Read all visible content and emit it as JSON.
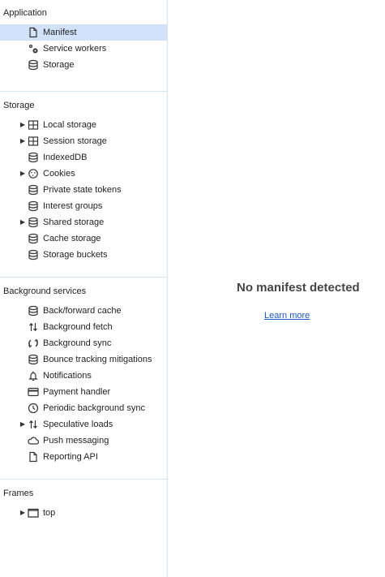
{
  "sidebar": {
    "application": {
      "title": "Application",
      "items": [
        {
          "label": "Manifest",
          "icon": "document-icon",
          "selected": true
        },
        {
          "label": "Service workers",
          "icon": "gears-icon"
        },
        {
          "label": "Storage",
          "icon": "database-icon"
        }
      ]
    },
    "storage": {
      "title": "Storage",
      "items": [
        {
          "label": "Local storage",
          "icon": "table-icon",
          "expandable": true
        },
        {
          "label": "Session storage",
          "icon": "table-icon",
          "expandable": true
        },
        {
          "label": "IndexedDB",
          "icon": "database-icon"
        },
        {
          "label": "Cookies",
          "icon": "cookie-icon",
          "expandable": true
        },
        {
          "label": "Private state tokens",
          "icon": "database-icon"
        },
        {
          "label": "Interest groups",
          "icon": "database-icon"
        },
        {
          "label": "Shared storage",
          "icon": "database-icon",
          "expandable": true
        },
        {
          "label": "Cache storage",
          "icon": "database-icon"
        },
        {
          "label": "Storage buckets",
          "icon": "database-icon"
        }
      ]
    },
    "background": {
      "title": "Background services",
      "items": [
        {
          "label": "Back/forward cache",
          "icon": "database-icon"
        },
        {
          "label": "Background fetch",
          "icon": "up-down-arrows-icon"
        },
        {
          "label": "Background sync",
          "icon": "sync-icon"
        },
        {
          "label": "Bounce tracking mitigations",
          "icon": "database-icon"
        },
        {
          "label": "Notifications",
          "icon": "bell-icon"
        },
        {
          "label": "Payment handler",
          "icon": "credit-card-icon"
        },
        {
          "label": "Periodic background sync",
          "icon": "clock-icon"
        },
        {
          "label": "Speculative loads",
          "icon": "up-down-arrows-icon",
          "expandable": true
        },
        {
          "label": "Push messaging",
          "icon": "cloud-icon"
        },
        {
          "label": "Reporting API",
          "icon": "document-icon"
        }
      ]
    },
    "frames": {
      "title": "Frames",
      "items": [
        {
          "label": "top",
          "icon": "frame-icon",
          "expandable": true
        }
      ]
    }
  },
  "main": {
    "empty_title": "No manifest detected",
    "learn_more": "Learn more"
  },
  "colors": {
    "selected_bg": "#d3e2fb",
    "divider": "#d6e4f5",
    "link": "#1a55c9"
  }
}
